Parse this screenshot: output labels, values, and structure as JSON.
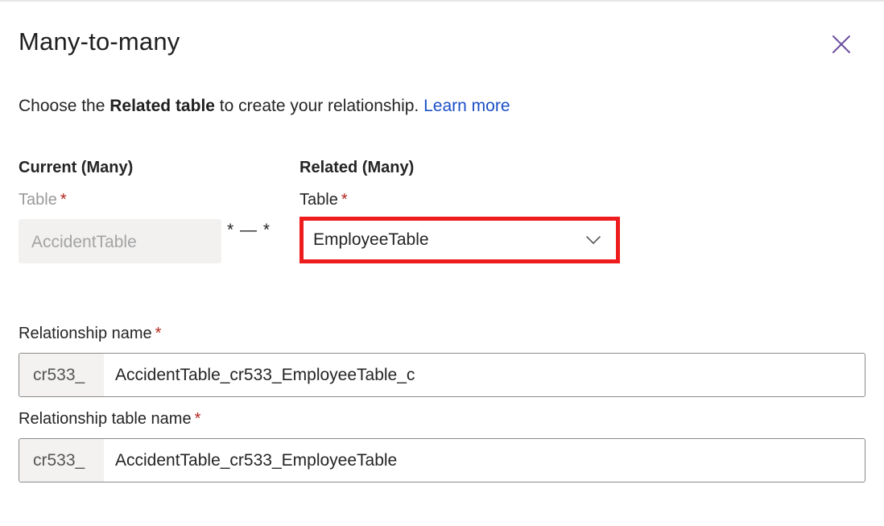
{
  "dialog": {
    "title": "Many-to-many",
    "close_icon": "close-icon"
  },
  "intro": {
    "prefix": "Choose the ",
    "bold": "Related table",
    "suffix": " to create your relationship. ",
    "link": "Learn more"
  },
  "current": {
    "heading": "Current (Many)",
    "table_label": "Table",
    "required": "*",
    "table_value": "AccidentTable"
  },
  "connector": "* — *",
  "related": {
    "heading": "Related (Many)",
    "table_label": "Table",
    "required": "*",
    "table_value": "EmployeeTable",
    "chevron_icon": "chevron-down-icon"
  },
  "relationship_name": {
    "label": "Relationship name",
    "required": "*",
    "prefix": "cr533_",
    "value": "AccidentTable_cr533_EmployeeTable_c"
  },
  "relationship_table_name": {
    "label": "Relationship table name",
    "required": "*",
    "prefix": "cr533_",
    "value": "AccidentTable_cr533_EmployeeTable"
  },
  "colors": {
    "accent_link": "#1a4fc7",
    "highlight_border": "#ee1c1c",
    "required": "#b3261e",
    "close_icon": "#6b4fa0"
  }
}
